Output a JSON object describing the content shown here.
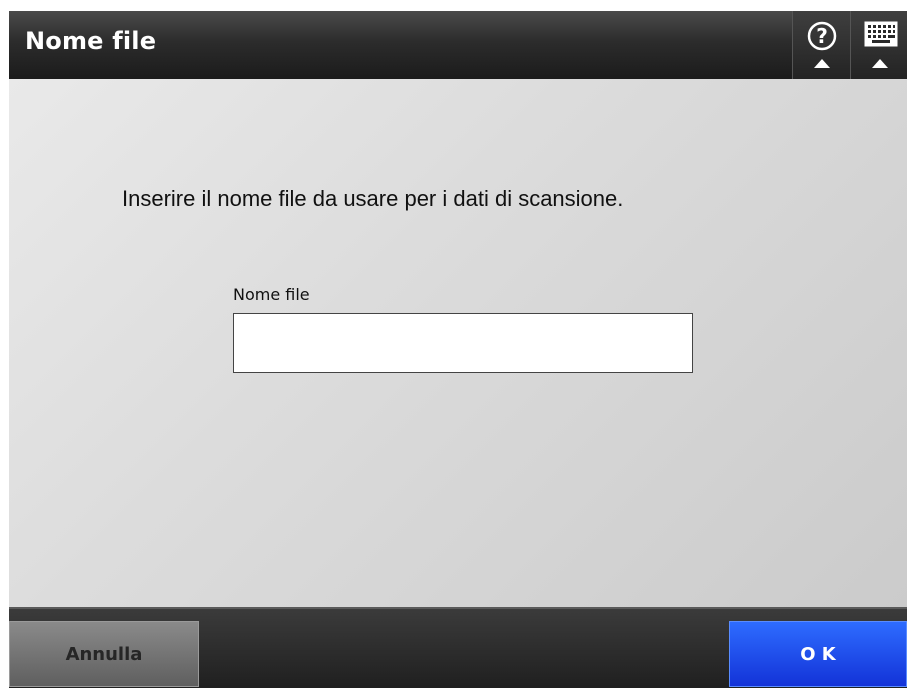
{
  "header": {
    "title": "Nome file",
    "help_icon": "help-question-icon",
    "keyboard_icon": "keyboard-icon"
  },
  "main": {
    "instruction": "Inserire il nome file da usare per i dati di scansione.",
    "field_label": "Nome file",
    "field_value": ""
  },
  "footer": {
    "cancel_label": "Annulla",
    "ok_label": "O K"
  },
  "colors": {
    "accent_ok": "#1f4fff",
    "header_bg": "#2c2c2c"
  }
}
